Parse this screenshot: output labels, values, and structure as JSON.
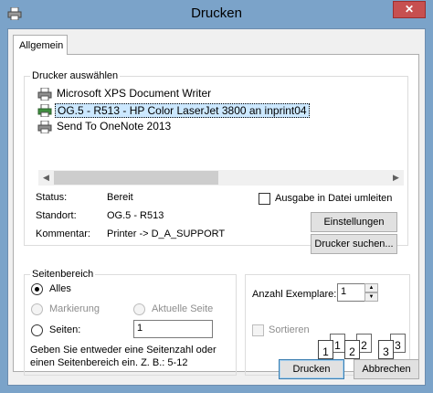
{
  "window": {
    "title": "Drucken",
    "close_glyph": "✕"
  },
  "tabs": [
    {
      "label": "Allgemein"
    }
  ],
  "printer_select": {
    "group_label": "Drucker auswählen",
    "printers": [
      {
        "name": "Microsoft XPS Document Writer",
        "icon": "printer-icon",
        "selected": false
      },
      {
        "name": "OG.5 - R513 - HP Color LaserJet 3800 an inprint04",
        "icon": "network-printer-icon",
        "selected": true
      },
      {
        "name": "Send To OneNote 2013",
        "icon": "printer-icon",
        "selected": false
      }
    ],
    "scroll_left": "◀",
    "scroll_right": "▶"
  },
  "status": {
    "status_label": "Status:",
    "status_value": "Bereit",
    "location_label": "Standort:",
    "location_value": "OG.5 - R513",
    "comment_label": "Kommentar:",
    "comment_value": "Printer -> D_A_SUPPORT"
  },
  "print_to_file": {
    "label": "Ausgabe in Datei umleiten",
    "checked": false
  },
  "buttons": {
    "settings": "Einstellungen",
    "find_printer": "Drucker suchen...",
    "print": "Drucken",
    "cancel": "Abbrechen"
  },
  "page_range": {
    "group_label": "Seitenbereich",
    "all": "Alles",
    "selection": "Markierung",
    "current_page": "Aktuelle Seite",
    "pages": "Seiten:",
    "pages_value": "1",
    "hint_line1": "Geben Sie entweder eine Seitenzahl oder",
    "hint_line2": "einen Seitenbereich ein. Z. B.: 5-12"
  },
  "copies": {
    "label": "Anzahl Exemplare:",
    "value": "1",
    "collate_label": "Sortieren",
    "collate_checked": false,
    "collate_pages": [
      "1",
      "1",
      "2",
      "2",
      "3",
      "3"
    ]
  }
}
